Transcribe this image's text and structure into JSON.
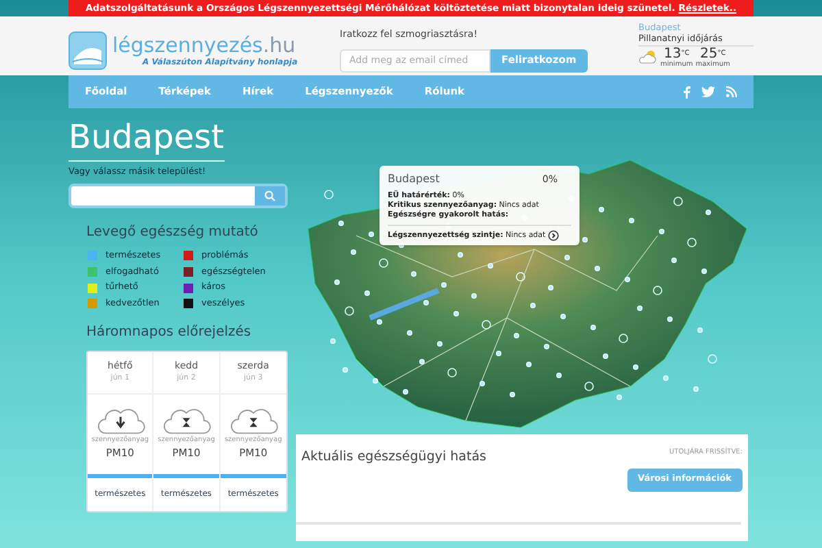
{
  "alert": {
    "text": "Adatszolgáltatásunk a Országos Légszennyezettségi Mérőhálózat költöztetése miatt bizonytalan ideig szünetel.",
    "link": "Részletek.."
  },
  "logo": {
    "name": "légszennyezés",
    "tld": ".hu",
    "tagline": "A Válaszúton Alapítvány honlapja"
  },
  "subscribe": {
    "label": "Iratkozz fel szmogriasztásra!",
    "placeholder": "Add meg az email címed",
    "button": "Feliratkozom"
  },
  "weather": {
    "city": "Budapest",
    "title": "Pillanatnyi időjárás",
    "min": "13",
    "max": "25",
    "min_unit": "°C",
    "max_unit": "°C",
    "min_label": "minimum",
    "max_label": "maximum"
  },
  "nav": {
    "items": [
      "Főoldal",
      "Térképek",
      "Hírek",
      "Légszennyezők",
      "Rólunk"
    ]
  },
  "city": {
    "name": "Budapest",
    "prompt": "Vagy válassz másik települést!"
  },
  "legend": {
    "title": "Levegő egészség mutató",
    "items": [
      {
        "label": "természetes",
        "color": "#4ab3f0"
      },
      {
        "label": "elfogadható",
        "color": "#3cc46c"
      },
      {
        "label": "tűrhető",
        "color": "#e0ef1a"
      },
      {
        "label": "kedvezőtlen",
        "color": "#d49a00"
      },
      {
        "label": "problémás",
        "color": "#d11a1a"
      },
      {
        "label": "egészségtelen",
        "color": "#7a1f22"
      },
      {
        "label": "káros",
        "color": "#6c1fb0"
      },
      {
        "label": "veszélyes",
        "color": "#111111"
      }
    ]
  },
  "forecast": {
    "title": "Háromnapos előrejelzés",
    "days": [
      {
        "day": "hétfő",
        "date": "jún 1",
        "kind": "falling",
        "pollutant_label": "szennyezőanyag",
        "pollutant": "PM10",
        "color": "#4ab3f0",
        "status": "természetes"
      },
      {
        "day": "kedd",
        "date": "jún 2",
        "kind": "steady",
        "pollutant_label": "szennyezőanyag",
        "pollutant": "PM10",
        "color": "#4ab3f0",
        "status": "természetes"
      },
      {
        "day": "szerda",
        "date": "jún 3",
        "kind": "steady",
        "pollutant_label": "szennyezőanyag",
        "pollutant": "PM10",
        "color": "#4ab3f0",
        "status": "természetes"
      }
    ]
  },
  "tooltip": {
    "city": "Budapest",
    "percent": "0%",
    "rows": [
      {
        "label": "EÜ határérték:",
        "value": "0%"
      },
      {
        "label": "Kritikus szennyezőanyag:",
        "value": "Nincs adat"
      },
      {
        "label": "Egészségre gyakorolt hatás:"
      }
    ],
    "level_label": "Légszennyezettség szintje:",
    "level_value": "Nincs adat"
  },
  "impact": {
    "title": "Aktuális egészségügyi hatás",
    "updated": "UTOLJÁRA FRISSÍTVE:",
    "button": "Városi információk"
  }
}
